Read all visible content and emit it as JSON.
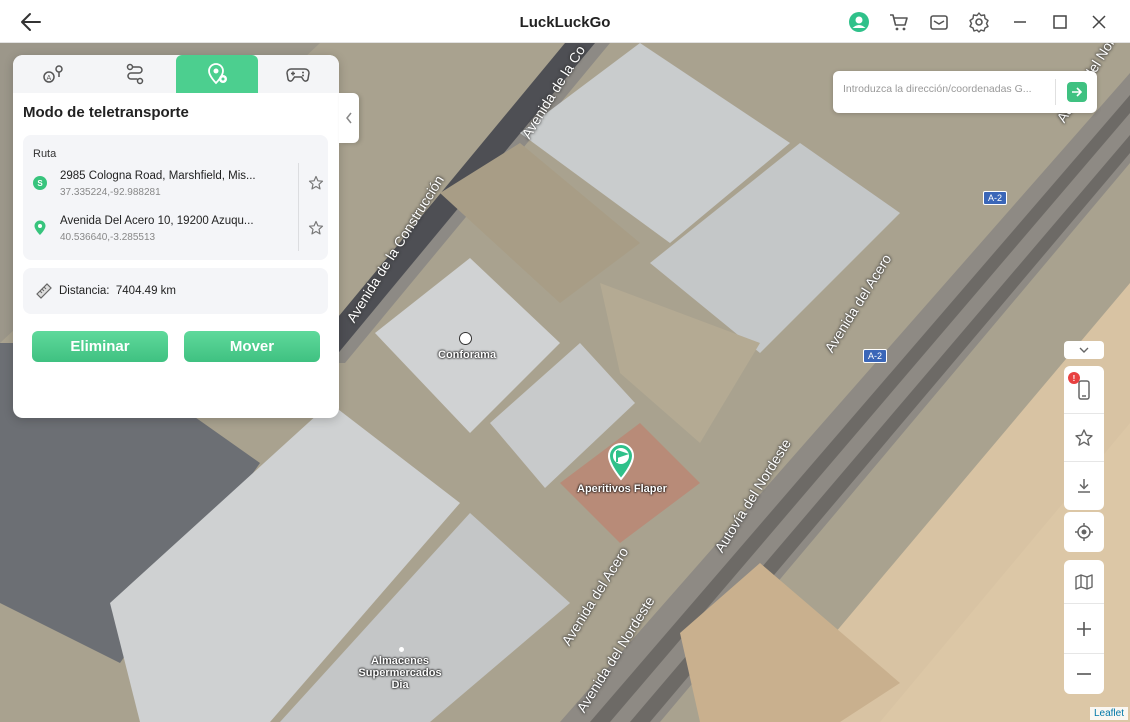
{
  "app": {
    "title": "LuckLuckGo"
  },
  "panel": {
    "title": "Modo de teletransporte",
    "route_label": "Ruta",
    "origin": {
      "badge": "S",
      "address": "2985 Cologna Road, Marshfield, Mis...",
      "coords": "37.335224,-92.988281"
    },
    "destination": {
      "address": "Avenida Del Acero 10, 19200 Azuqu...",
      "coords": "40.536640,-3.285513"
    },
    "distance_label": "Distancia:",
    "distance_value": "7404.49 km",
    "delete_label": "Eliminar",
    "move_label": "Mover"
  },
  "search": {
    "placeholder": "Introduzca la dirección/coordenadas G...",
    "value": ""
  },
  "map": {
    "labels": {
      "conforama": "Conforama",
      "aperitivos": "Aperitivos Flaper",
      "almacenes": "Almacenes Supermercados Dia",
      "av_construccion_1": "Avenida de la Construcción",
      "av_construccion_2": "Avenida de la Co",
      "av_acero_1": "Avenida del Acero",
      "av_acero_2": "Avenida del Acero",
      "av_nordeste_1": "Autovía del Nordeste",
      "av_nordeste_2": "Avenida del Nordeste",
      "autovia_nordeste": "Autovía del Nordeste",
      "a2_shield": "A-2",
      "ruta_top": "Autovía del Nordeste"
    },
    "attribution": "Leaflet"
  },
  "controls": {
    "alert_badge": "!"
  },
  "colors": {
    "accent": "#3fc181",
    "alert": "#e84040",
    "shield": "#3a66b8"
  }
}
